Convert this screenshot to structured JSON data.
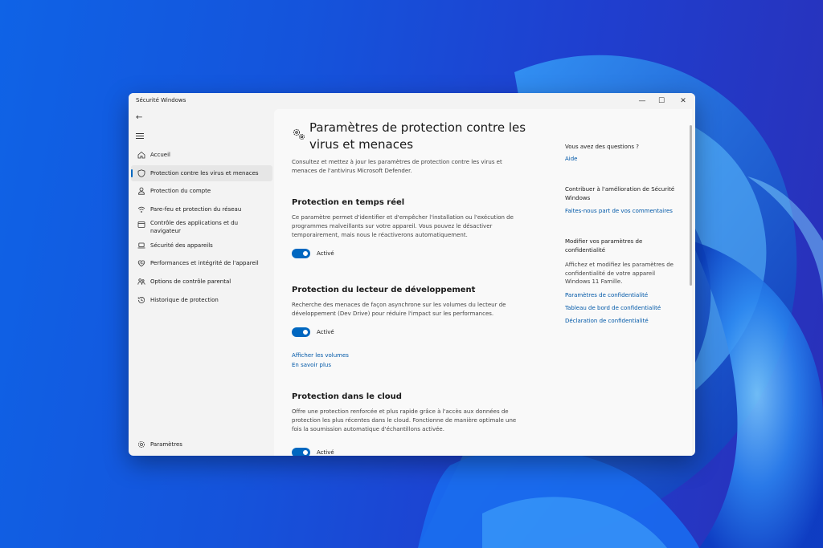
{
  "window": {
    "title": "Sécurité Windows",
    "controls": {
      "minimize": "—",
      "maximize": "☐",
      "close": "✕"
    }
  },
  "sidebar": {
    "back": "←",
    "items": [
      {
        "label": "Accueil",
        "icon": "home-icon"
      },
      {
        "label": "Protection contre les virus et menaces",
        "icon": "shield-icon",
        "active": true
      },
      {
        "label": "Protection du compte",
        "icon": "person-icon"
      },
      {
        "label": "Pare-feu et protection du réseau",
        "icon": "wifi-icon"
      },
      {
        "label": "Contrôle des applications et du navigateur",
        "icon": "app-window-icon"
      },
      {
        "label": "Sécurité des appareils",
        "icon": "laptop-icon"
      },
      {
        "label": "Performances et intégrité de l'appareil",
        "icon": "heart-icon"
      },
      {
        "label": "Options de contrôle parental",
        "icon": "family-icon"
      },
      {
        "label": "Historique de protection",
        "icon": "history-icon"
      }
    ],
    "settings": {
      "label": "Paramètres",
      "icon": "gear-icon"
    }
  },
  "main": {
    "title": "Paramètres de protection contre les virus et menaces",
    "description": "Consultez et mettez à jour les paramètres de protection contre les virus et menaces de l'antivirus Microsoft Defender.",
    "sections": [
      {
        "title": "Protection en temps réel",
        "description": "Ce paramètre permet d'identifier et d'empêcher l'installation ou l'exécution de programmes malveillants sur votre appareil. Vous pouvez le désactiver temporairement, mais nous le réactiverons automatiquement.",
        "toggle_label": "Activé"
      },
      {
        "title": "Protection du lecteur de développement",
        "description": "Recherche des menaces de façon asynchrone sur les volumes du lecteur de développement (Dev Drive) pour réduire l'impact sur les performances.",
        "toggle_label": "Activé",
        "links": [
          "Afficher les volumes",
          "En savoir plus"
        ]
      },
      {
        "title": "Protection dans le cloud",
        "description": "Offre une protection renforcée et plus rapide grâce à l'accès aux données de protection les plus récentes dans le cloud. Fonctionne de manière optimale une fois la soumission automatique d'échantillons activée.",
        "toggle_label": "Activé"
      }
    ]
  },
  "aside": {
    "questions": {
      "heading": "Vous avez des questions ?",
      "link": "Aide"
    },
    "improve": {
      "heading": "Contribuer à l'amélioration de Sécurité Windows",
      "link": "Faites-nous part de vos commentaires"
    },
    "privacy": {
      "heading": "Modifier vos paramètres de confidentialité",
      "text": "Affichez et modifiez les paramètres de confidentialité de votre appareil Windows 11 Famille.",
      "links": [
        "Paramètres de confidentialité",
        "Tableau de bord de confidentialité",
        "Déclaration de confidentialité"
      ]
    }
  },
  "colors": {
    "accent": "#0067c0",
    "link": "#0058a8",
    "wallpaper": "#1553db"
  }
}
